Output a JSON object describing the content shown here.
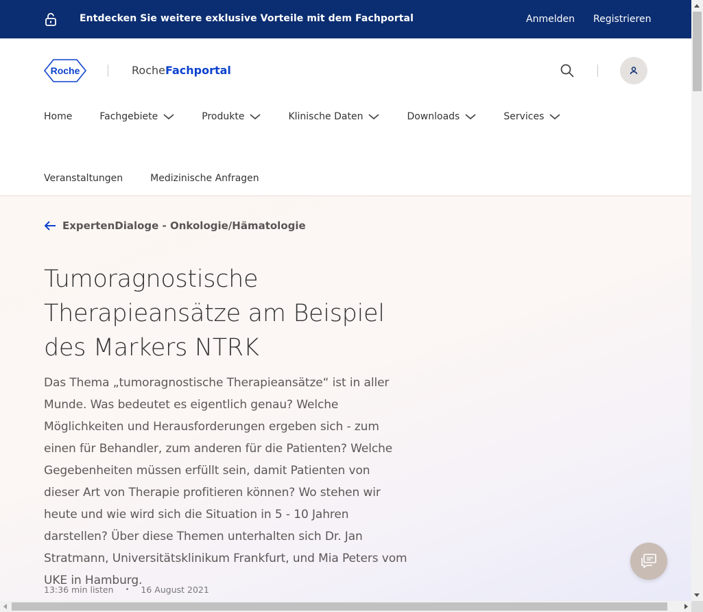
{
  "topbar": {
    "promo": "Entdecken Sie weitere exklusive Vorteile mit dem Fachportal",
    "login": "Anmelden",
    "register": "Registrieren",
    "icon": "lock-icon",
    "bg_color": "#0b2d71"
  },
  "header": {
    "logo_text": "Roche",
    "portal_prefix": "Roche",
    "portal_name": "Fachportal",
    "brand_color": "#0b41cd"
  },
  "nav": {
    "primary": [
      {
        "label": "Home"
      },
      {
        "label": "Fachgebiete"
      },
      {
        "label": "Produkte"
      },
      {
        "label": "Klinische Daten"
      },
      {
        "label": "Downloads"
      },
      {
        "label": "Services"
      }
    ],
    "secondary": [
      {
        "label": "Veranstaltungen"
      },
      {
        "label": "Medizinische Anfragen"
      }
    ]
  },
  "article": {
    "back_label": "ExpertenDialoge - Onkologie/Hämatologie",
    "title": "Tumoragnostische Therapieansätze am Beispiel des Markers NTRK",
    "description": "Das Thema „tumoragnostische Therapieansätze“ ist in aller Munde. Was bedeutet es eigentlich genau? Welche Möglichkeiten und Herausforderungen ergeben sich - zum einen für Behandler, zum anderen für die Patienten? Welche Gegebenheiten müssen erfüllt sein, damit Patienten von dieser Art von Therapie profitieren können? Wo stehen wir heute und wie wird sich die Situation in 5 - 10 Jahren darstellen? Über diese Themen unterhalten sich Dr. Jan Stratmann, Universitätsklinikum Frankfurt, und Mia Peters vom UKE in Hamburg.",
    "duration": "13:36 min listen",
    "date": "16 August 2021"
  }
}
